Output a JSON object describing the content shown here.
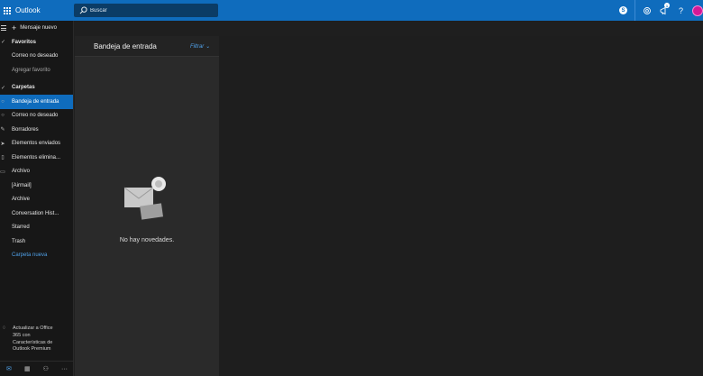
{
  "header": {
    "app_title": "Outlook",
    "search_placeholder": "Buscar",
    "icons": [
      "skype-icon",
      "gear-icon",
      "megaphone-icon",
      "help-icon",
      "avatar"
    ],
    "notification_count": "1",
    "accent_color": "#0f6cbd"
  },
  "sidebar": {
    "new_message_label": "Mensaje nuevo",
    "favorites_title": "Favoritos",
    "favorites": [
      {
        "label": "Correo no deseado"
      },
      {
        "label": "Agregar favorito"
      }
    ],
    "folders_title": "Carpetas",
    "folders": [
      {
        "label": "Bandeja de entrada",
        "icon": "inbox-icon",
        "active": true
      },
      {
        "label": "Correo no deseado",
        "icon": "junk-icon"
      },
      {
        "label": "Borradores",
        "icon": "pencil-icon"
      },
      {
        "label": "Elementos enviados",
        "icon": "send-icon"
      },
      {
        "label": "Elementos elimina...",
        "icon": "trash-icon"
      },
      {
        "label": "Archivo",
        "icon": "archive-icon"
      },
      {
        "label": "[Airmail]"
      },
      {
        "label": "Archive"
      },
      {
        "label": "Conversation Hist..."
      },
      {
        "label": "Starred"
      },
      {
        "label": "Trash"
      },
      {
        "label": "Carpeta nueva"
      }
    ],
    "upgrade_text": [
      "Actualizar a Office",
      "365 con",
      "Características de",
      "Outlook Premium"
    ],
    "bottom_icons": [
      "mail-icon",
      "calendar-icon",
      "people-icon",
      "more-icon"
    ]
  },
  "message_list": {
    "title": "Bandeja de entrada",
    "filter_label": "Filtrar",
    "empty_text": "No hay novedades."
  }
}
